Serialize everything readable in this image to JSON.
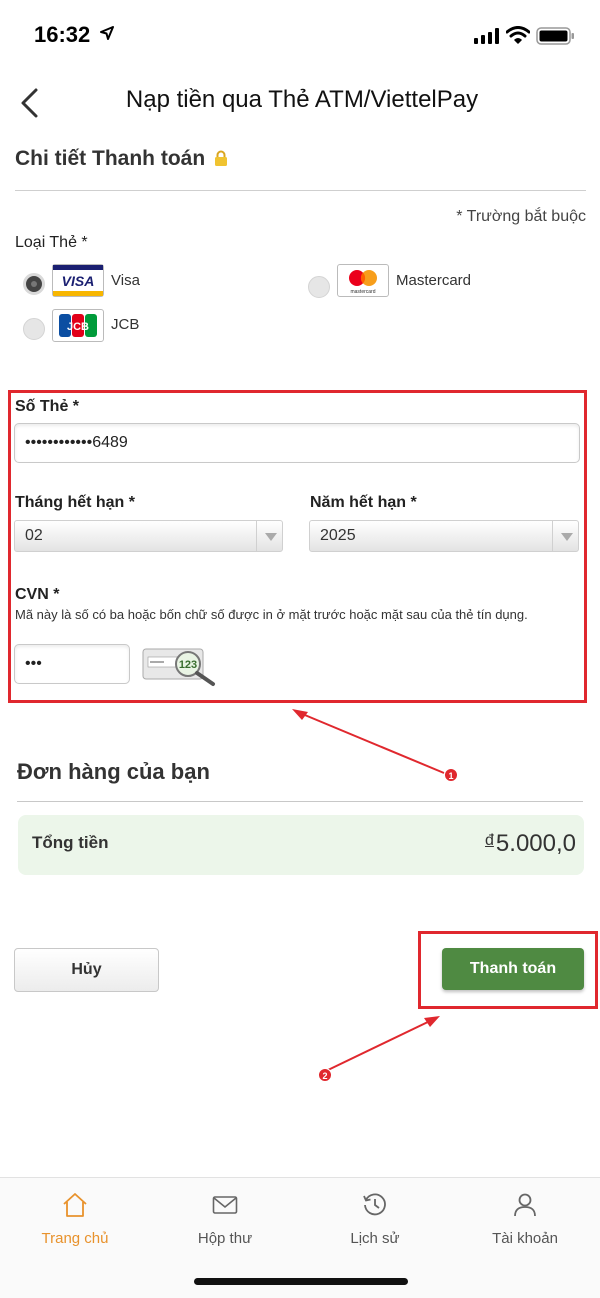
{
  "status_bar": {
    "time": "16:32"
  },
  "header": {
    "title": "Nạp tiền qua Thẻ ATM/ViettelPay"
  },
  "payment_details": {
    "title": "Chi tiết Thanh toán",
    "required_note": "* Trường bắt buộc",
    "card_type_label": "Loại Thẻ *",
    "card_types": [
      {
        "name": "Visa",
        "logo_text": "VISA",
        "selected": true
      },
      {
        "name": "Mastercard",
        "logo_text": "mastercard",
        "selected": false
      },
      {
        "name": "JCB",
        "logo_text": "JCB",
        "selected": false
      }
    ],
    "card_number": {
      "label": "Số Thẻ *",
      "value": "••••••••••••6489"
    },
    "expiry_month": {
      "label": "Tháng hết hạn *",
      "value": "02"
    },
    "expiry_year": {
      "label": "Năm hết hạn *",
      "value": "2025"
    },
    "cvn": {
      "label": "CVN *",
      "hint": "Mã này là số có ba hoặc bốn chữ số được in ở mặt trước hoặc mặt sau của thẻ tín dụng.",
      "value": "•••",
      "image_text": "123"
    }
  },
  "order": {
    "title": "Đơn hàng của bạn",
    "total_label": "Tổng tiền",
    "currency": "đ",
    "total_amount": "5.000,0"
  },
  "actions": {
    "cancel_label": "Hủy",
    "pay_label": "Thanh toán"
  },
  "annotations": {
    "step1": "1",
    "step2": "2",
    "highlight_color": "#e0282e"
  },
  "bottom_nav": {
    "items": [
      {
        "label": "Trang chủ",
        "icon": "home-icon",
        "active": true
      },
      {
        "label": "Hộp thư",
        "icon": "mail-icon",
        "active": false
      },
      {
        "label": "Lịch sử",
        "icon": "history-icon",
        "active": false
      },
      {
        "label": "Tài khoản",
        "icon": "account-icon",
        "active": false
      }
    ]
  },
  "colors": {
    "accent": "#e8922c",
    "primary_button": "#4f8a42",
    "total_bg": "#ecf6ea"
  }
}
